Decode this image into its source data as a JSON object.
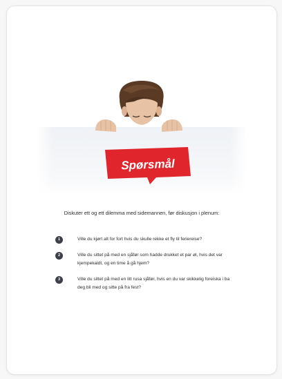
{
  "hero": {
    "sign_label": "Spørsmål",
    "colors": {
      "sign_red": "#e0262c",
      "sign_text": "#ffffff",
      "board": "#f3f5f7",
      "hair": "#5a3a25",
      "skin": "#e7c2a4"
    }
  },
  "instruction": "Diskuter ett og ett dilemma med sidemannen, før diskusjon i plenum:",
  "questions": [
    {
      "number": "1",
      "text": "Ville du kjørt alt for fort hvis du skulle rekke et fly til feriereise?"
    },
    {
      "number": "2",
      "text": "Ville du sittet på med en sjåfør som hadde drukket et par øl, hvis det var kjempekaldt, og en time å gå hjem?"
    },
    {
      "number": "3",
      "text": "Ville du sittet på med en litt rusa sjåfør, hvis en du var skikkelig foreiska i ba deg bli med og sitte på fra fest?"
    }
  ]
}
